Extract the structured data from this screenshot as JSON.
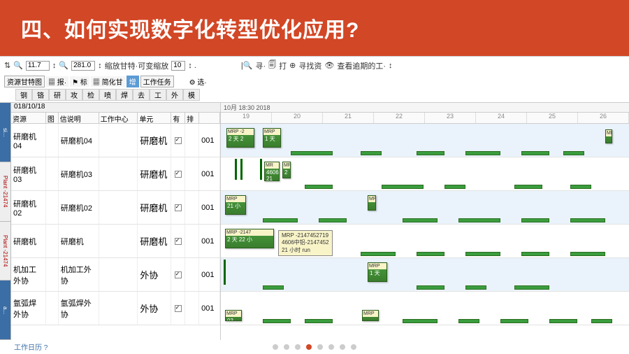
{
  "title": "四、如何实现数字化转型优化应用?",
  "toolbar1": {
    "zoom1": "11.7",
    "zoom2": "281.0",
    "scale_label": "缩放甘特·可变缩放",
    "scale_val": "10",
    "find": "寻·",
    "print": "打",
    "find_res": "寻找资",
    "overdue": "查看逾期的工·"
  },
  "toolbar2": {
    "a": "资源甘特图",
    "b": "报·",
    "c": "标",
    "d": "简化甘",
    "e": "增",
    "f": "工作任务",
    "g": "选·"
  },
  "tabs3": [
    "钢",
    "铬",
    "研",
    "攻",
    "检",
    "喷",
    "焊",
    "去",
    "工",
    "外",
    "模"
  ],
  "side_tabs": [
    "si...",
    "Plant -21474",
    "Plant -21474",
    "a..."
  ],
  "date_left": "018/10/18",
  "columns": {
    "res": "资源",
    "img": "图",
    "desc": "信说明",
    "wc": "工作中心",
    "unit": "单元",
    "you": "有",
    "pai": "排",
    "row": ""
  },
  "rows": [
    {
      "res": "研磨机04",
      "desc": "研磨机04",
      "unit": "研磨机",
      "row": "001"
    },
    {
      "res": "研磨机03",
      "desc": "研磨机03",
      "unit": "研磨机",
      "row": "001"
    },
    {
      "res": "研磨机02",
      "desc": "研磨机02",
      "unit": "研磨机",
      "row": "001"
    },
    {
      "res": "研磨机",
      "desc": "研磨机",
      "unit": "研磨机",
      "row": "001"
    },
    {
      "res": "机加工外协",
      "desc": "机加工外协",
      "unit": "外协",
      "row": "001"
    },
    {
      "res": "氩弧焊外协",
      "desc": "氩弧焊外协",
      "unit": "外协",
      "row": "001"
    }
  ],
  "gantt_head": "10月  18:30  2018",
  "days": [
    "19",
    "20",
    "21",
    "22",
    "23",
    "24",
    "25",
    "26"
  ],
  "bars": {
    "r0a_t": "MRP -2",
    "r0a_b": "2 天 2",
    "r0b_t": "MRP",
    "r0b_b": "1 天",
    "r1a_t": "MR",
    "r1a_b": "4606\n21",
    "r2a_t": "MRP",
    "r2a_b": "21 小",
    "r3a_t": "MRP -2147",
    "r3a_b": "2 天 22 小",
    "r4a_t": "MRP",
    "r4a_b": "1 天",
    "r5a_t": "MRP",
    "r5a_b": "03"
  },
  "tooltip": "MRP -2147452719\n4606中铝-2147452\n21 小时 run",
  "footer": "工作日历 ?"
}
